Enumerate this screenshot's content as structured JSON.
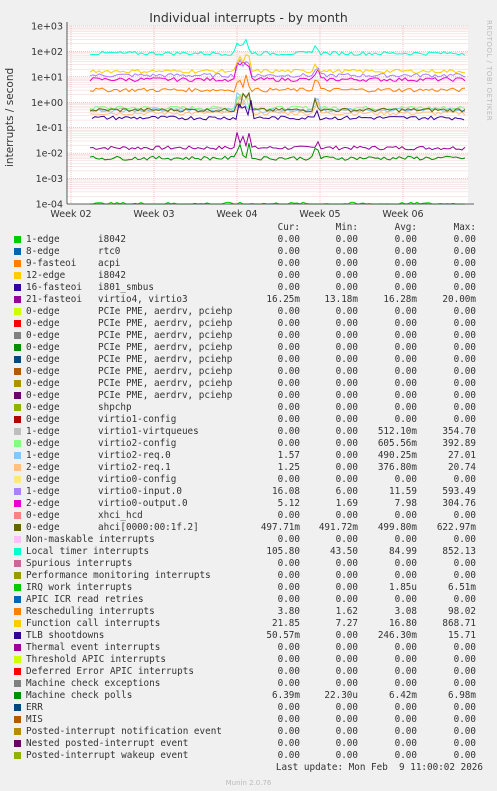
{
  "title": "Individual interrupts - by month",
  "ylabel": "interrupts / second",
  "watermark": "RRDTOOL / TOBI OETIKER",
  "footer": "Munin 2.0.76",
  "last_update": "Last update: Mon Feb  9 11:00:02 2026",
  "columns": [
    "Cur:",
    "Min:",
    "Avg:",
    "Max:"
  ],
  "chart_data": {
    "type": "line",
    "y_scale": "log",
    "ylim": [
      0.0001,
      1000
    ],
    "y_ticks": [
      "1e+03",
      "1e+02",
      "1e+01",
      "1e+00",
      "1e-01",
      "1e-02",
      "1e-03",
      "1e-04"
    ],
    "x_ticks": [
      "Week 02",
      "Week 03",
      "Week 04",
      "Week 05",
      "Week 06"
    ],
    "grid": true,
    "legend": "below",
    "series": [
      {
        "name": "1-edge",
        "device": "i8042",
        "color": "#00cc00",
        "cur": "0.00",
        "min": "0.00",
        "avg": "0.00",
        "max": "0.00"
      },
      {
        "name": "8-edge",
        "device": "rtc0",
        "color": "#0066b3",
        "cur": "0.00",
        "min": "0.00",
        "avg": "0.00",
        "max": "0.00"
      },
      {
        "name": "9-fasteoi",
        "device": "acpi",
        "color": "#ff8000",
        "cur": "0.00",
        "min": "0.00",
        "avg": "0.00",
        "max": "0.00"
      },
      {
        "name": "12-edge",
        "device": "i8042",
        "color": "#ffcc00",
        "cur": "0.00",
        "min": "0.00",
        "avg": "0.00",
        "max": "0.00"
      },
      {
        "name": "16-fasteoi",
        "device": "i801_smbus",
        "color": "#330099",
        "cur": "0.00",
        "min": "0.00",
        "avg": "0.00",
        "max": "0.00"
      },
      {
        "name": "21-fasteoi",
        "device": "virtio4, virtio3",
        "color": "#990099",
        "cur": "16.25m",
        "min": "13.18m",
        "avg": "16.28m",
        "max": "20.00m"
      },
      {
        "name": "0-edge",
        "device": "PCIe PME, aerdrv, pciehp",
        "color": "#ccff00",
        "cur": "0.00",
        "min": "0.00",
        "avg": "0.00",
        "max": "0.00"
      },
      {
        "name": "0-edge",
        "device": "PCIe PME, aerdrv, pciehp",
        "color": "#ff0000",
        "cur": "0.00",
        "min": "0.00",
        "avg": "0.00",
        "max": "0.00"
      },
      {
        "name": "0-edge",
        "device": "PCIe PME, aerdrv, pciehp",
        "color": "#808080",
        "cur": "0.00",
        "min": "0.00",
        "avg": "0.00",
        "max": "0.00"
      },
      {
        "name": "0-edge",
        "device": "PCIe PME, aerdrv, pciehp",
        "color": "#008f00",
        "cur": "0.00",
        "min": "0.00",
        "avg": "0.00",
        "max": "0.00"
      },
      {
        "name": "0-edge",
        "device": "PCIe PME, aerdrv, pciehp",
        "color": "#00487d",
        "cur": "0.00",
        "min": "0.00",
        "avg": "0.00",
        "max": "0.00"
      },
      {
        "name": "0-edge",
        "device": "PCIe PME, aerdrv, pciehp",
        "color": "#b35a00",
        "cur": "0.00",
        "min": "0.00",
        "avg": "0.00",
        "max": "0.00"
      },
      {
        "name": "0-edge",
        "device": "PCIe PME, aerdrv, pciehp",
        "color": "#b38f00",
        "cur": "0.00",
        "min": "0.00",
        "avg": "0.00",
        "max": "0.00"
      },
      {
        "name": "0-edge",
        "device": "PCIe PME, aerdrv, pciehp",
        "color": "#6b006b",
        "cur": "0.00",
        "min": "0.00",
        "avg": "0.00",
        "max": "0.00"
      },
      {
        "name": "0-edge",
        "device": "shpchp",
        "color": "#8fb300",
        "cur": "0.00",
        "min": "0.00",
        "avg": "0.00",
        "max": "0.00"
      },
      {
        "name": "0-edge",
        "device": "virtio1-config",
        "color": "#b30000",
        "cur": "0.00",
        "min": "0.00",
        "avg": "0.00",
        "max": "0.00"
      },
      {
        "name": "1-edge",
        "device": "virtio1-virtqueues",
        "color": "#bebebe",
        "cur": "0.00",
        "min": "0.00",
        "avg": "512.10m",
        "max": "354.70"
      },
      {
        "name": "0-edge",
        "device": "virtio2-config",
        "color": "#80ff80",
        "cur": "0.00",
        "min": "0.00",
        "avg": "605.56m",
        "max": "392.89"
      },
      {
        "name": "1-edge",
        "device": "virtio2-req.0",
        "color": "#80c9ff",
        "cur": "1.57",
        "min": "0.00",
        "avg": "490.25m",
        "max": "27.01"
      },
      {
        "name": "2-edge",
        "device": "virtio2-req.1",
        "color": "#ffc080",
        "cur": "1.25",
        "min": "0.00",
        "avg": "376.80m",
        "max": "20.74"
      },
      {
        "name": "0-edge",
        "device": "virtio0-config",
        "color": "#ffe680",
        "cur": "0.00",
        "min": "0.00",
        "avg": "0.00",
        "max": "0.00"
      },
      {
        "name": "1-edge",
        "device": "virtio0-input.0",
        "color": "#aa80ff",
        "cur": "16.08",
        "min": "6.00",
        "avg": "11.59",
        "max": "593.49"
      },
      {
        "name": "2-edge",
        "device": "virtio0-output.0",
        "color": "#ee00cc",
        "cur": "5.12",
        "min": "1.69",
        "avg": "7.98",
        "max": "304.76"
      },
      {
        "name": "0-edge",
        "device": "xhci_hcd",
        "color": "#ff8080",
        "cur": "0.00",
        "min": "0.00",
        "avg": "0.00",
        "max": "0.00"
      },
      {
        "name": "0-edge",
        "device": "ahci[0000:00:1f.2]",
        "color": "#666600",
        "cur": "497.71m",
        "min": "491.72m",
        "avg": "499.80m",
        "max": "622.97m"
      },
      {
        "name": "Non-maskable interrupts",
        "device": "",
        "color": "#ffbfff",
        "cur": "0.00",
        "min": "0.00",
        "avg": "0.00",
        "max": "0.00"
      },
      {
        "name": "Local timer interrupts",
        "device": "",
        "color": "#00ffcc",
        "cur": "105.80",
        "min": "43.50",
        "avg": "84.99",
        "max": "852.13"
      },
      {
        "name": "Spurious interrupts",
        "device": "",
        "color": "#cc6699",
        "cur": "0.00",
        "min": "0.00",
        "avg": "0.00",
        "max": "0.00"
      },
      {
        "name": "Performance monitoring interrupts",
        "device": "",
        "color": "#999900",
        "cur": "0.00",
        "min": "0.00",
        "avg": "0.00",
        "max": "0.00"
      },
      {
        "name": "IRQ work interrupts",
        "device": "",
        "color": "#00cc00",
        "cur": "0.00",
        "min": "0.00",
        "avg": "1.85u",
        "max": "6.51m"
      },
      {
        "name": "APIC ICR read retries",
        "device": "",
        "color": "#0066b3",
        "cur": "0.00",
        "min": "0.00",
        "avg": "0.00",
        "max": "0.00"
      },
      {
        "name": "Rescheduling interrupts",
        "device": "",
        "color": "#ff8000",
        "cur": "3.80",
        "min": "1.62",
        "avg": "3.08",
        "max": "98.02"
      },
      {
        "name": "Function call interrupts",
        "device": "",
        "color": "#ffcc00",
        "cur": "21.85",
        "min": "7.27",
        "avg": "16.80",
        "max": "868.71"
      },
      {
        "name": "TLB shootdowns",
        "device": "",
        "color": "#330099",
        "cur": "50.57m",
        "min": "0.00",
        "avg": "246.30m",
        "max": "15.71"
      },
      {
        "name": "Thermal event interrupts",
        "device": "",
        "color": "#990099",
        "cur": "0.00",
        "min": "0.00",
        "avg": "0.00",
        "max": "0.00"
      },
      {
        "name": "Threshold APIC interrupts",
        "device": "",
        "color": "#ccff00",
        "cur": "0.00",
        "min": "0.00",
        "avg": "0.00",
        "max": "0.00"
      },
      {
        "name": "Deferred Error APIC interrupts",
        "device": "",
        "color": "#ff0000",
        "cur": "0.00",
        "min": "0.00",
        "avg": "0.00",
        "max": "0.00"
      },
      {
        "name": "Machine check exceptions",
        "device": "",
        "color": "#808080",
        "cur": "0.00",
        "min": "0.00",
        "avg": "0.00",
        "max": "0.00"
      },
      {
        "name": "Machine check polls",
        "device": "",
        "color": "#008f00",
        "cur": "6.39m",
        "min": "22.30u",
        "avg": "6.42m",
        "max": "6.98m"
      },
      {
        "name": "ERR",
        "device": "",
        "color": "#00487d",
        "cur": "0.00",
        "min": "0.00",
        "avg": "0.00",
        "max": "0.00"
      },
      {
        "name": "MIS",
        "device": "",
        "color": "#b35a00",
        "cur": "0.00",
        "min": "0.00",
        "avg": "0.00",
        "max": "0.00"
      },
      {
        "name": "Posted-interrupt notification event",
        "device": "",
        "color": "#b38f00",
        "cur": "0.00",
        "min": "0.00",
        "avg": "0.00",
        "max": "0.00"
      },
      {
        "name": "Nested posted-interrupt event",
        "device": "",
        "color": "#6b006b",
        "cur": "0.00",
        "min": "0.00",
        "avg": "0.00",
        "max": "0.00"
      },
      {
        "name": "Posted-interrupt wakeup event",
        "device": "",
        "color": "#8fb300",
        "cur": "0.00",
        "min": "0.00",
        "avg": "0.00",
        "max": "0.00"
      }
    ]
  }
}
